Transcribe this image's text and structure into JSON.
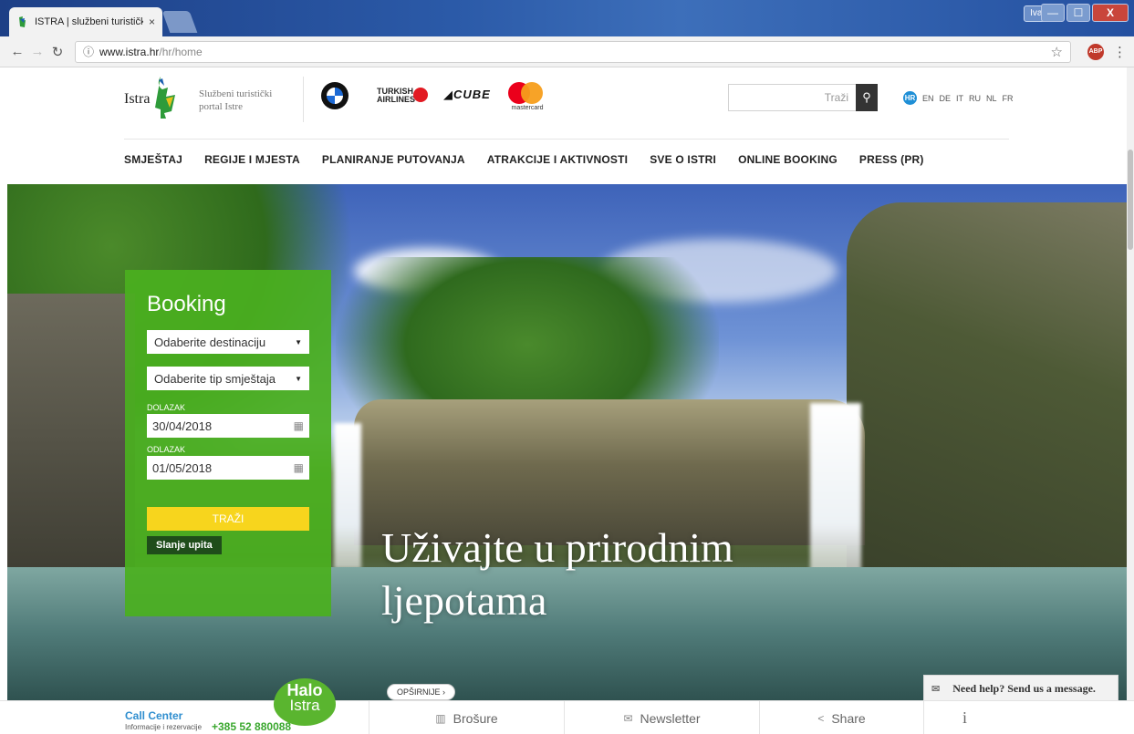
{
  "browser": {
    "tab_title": "ISTRA | službeni turistički",
    "tab_close": "×",
    "user_badge": "Ivan",
    "url_host": "www.istra.hr",
    "url_path": "/hr/home",
    "ext_label": "ABP",
    "controls": {
      "minimize": "—",
      "maximize": "☐",
      "close": "X"
    }
  },
  "header": {
    "logo_text": "Istra",
    "tagline_line1": "Službeni turistički",
    "tagline_line2": "portal Istre",
    "sponsors": {
      "turkish_line1": "TURKISH",
      "turkish_line2": "AIRLINES",
      "cube": "CUBE",
      "mastercard": "mastercard"
    },
    "search_placeholder": "Traži",
    "languages": {
      "active": "HR",
      "others": [
        "EN",
        "DE",
        "IT",
        "RU",
        "NL",
        "FR"
      ]
    }
  },
  "nav": [
    "SMJEŠTAJ",
    "REGIJE I MJESTA",
    "PLANIRANJE PUTOVANJA",
    "ATRAKCIJE I AKTIVNOSTI",
    "SVE O ISTRI",
    "ONLINE BOOKING",
    "PRESS (PR)"
  ],
  "booking": {
    "title": "Booking",
    "destination": "Odaberite destinaciju",
    "accommodation_type": "Odaberite tip smještaja",
    "arrival_label": "DOLAZAK",
    "arrival_date": "30/04/2018",
    "departure_label": "ODLAZAK",
    "departure_date": "01/05/2018",
    "search_button": "TRAŽI",
    "inquiry_button": "Slanje upita"
  },
  "hero": {
    "headline": "Uživajte u prirodnim ljepotama",
    "more_button": "OPŠIRNIJE ›"
  },
  "chat": {
    "text": "Need help? Send us a message."
  },
  "bottom": {
    "halo_line1": "Halo",
    "halo_line2": "Istra",
    "call_title": "Call Center",
    "call_sub": "Informacije i rezervacije",
    "call_phone": "+385 52 880088",
    "brochures": "Brošure",
    "newsletter": "Newsletter",
    "share": "Share",
    "info": "i"
  },
  "colors": {
    "booking_green": "#4aaf1f",
    "search_yellow": "#f7d51d",
    "call_blue": "#2f8ecf",
    "phone_green": "#3aa72e"
  }
}
